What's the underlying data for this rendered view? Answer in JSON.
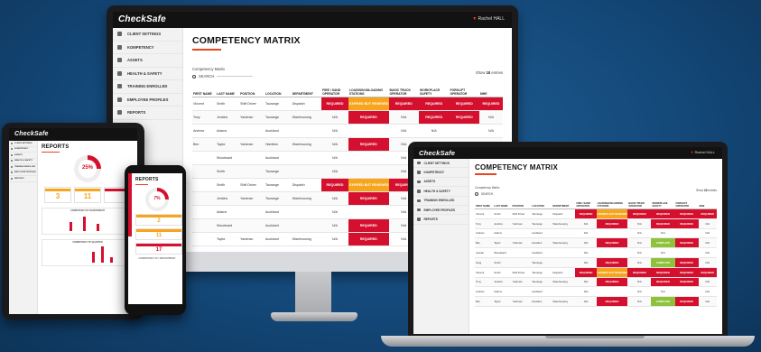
{
  "app": {
    "logo": "CheckSafe",
    "user": "Rachel HALL"
  },
  "sidebar": {
    "items": [
      {
        "label": "CLIENT SETTINGS",
        "icon": "gear-icon"
      },
      {
        "label": "KOMPETENCY",
        "icon": "check-icon"
      },
      {
        "label": "ASSETS",
        "icon": "box-icon"
      },
      {
        "label": "HEALTH & SAFETY",
        "icon": "cross-icon"
      },
      {
        "label": "TRAINING ENROLLED",
        "icon": "cap-icon"
      },
      {
        "label": "EMPLOYEE PROFILES",
        "icon": "user-icon"
      },
      {
        "label": "REPORTS",
        "icon": "chart-icon"
      }
    ]
  },
  "matrix": {
    "title": "COMPETENCY MATRIX",
    "subtitle": "Competency Matrix",
    "search_placeholder": "SEARCH",
    "show_label": "Show",
    "show_value": "10",
    "entries_label": "entries",
    "headers": [
      "FIRST NAME",
      "LAST NAME",
      "POSITION",
      "LOCATION",
      "DEPARTMENT",
      "FIRE / SAND OPERATOR",
      "LOADING/UNLOADING STATIONS",
      "BASIC TRUCK OPERATOR",
      "WORKPLACE SAFETY",
      "FORKLIFT OPERATOR",
      "MHE"
    ],
    "rows": [
      [
        "Vincent",
        "Smith",
        "Shift Driver",
        "Taurange",
        "Dispatch",
        "REQUIRED",
        "EXPIRED BUT RENEWED",
        "REQUIRED",
        "REQUIRED",
        "REQUIRED",
        "REQUIRED"
      ],
      [
        "Tony",
        "Jenkins",
        "Yardman",
        "Taurange",
        "Warehousing",
        "N/A",
        "REQUIRED",
        "N/A",
        "REQUIRED",
        "REQUIRED",
        "N/A"
      ],
      [
        "Andrew",
        "Adams",
        "",
        "Auckland",
        "",
        "N/A",
        "",
        "N/A",
        "N/A",
        "",
        "N/A"
      ],
      [
        "Ben",
        "Taylor",
        "Yardman",
        "Hamilton",
        "Warehousing",
        "N/A",
        "REQUIRED",
        "N/A",
        "N/A",
        "",
        "N/A"
      ],
      [
        "",
        "Woodward",
        "",
        "Auckland",
        "",
        "N/A",
        "",
        "N/A",
        "N/A",
        "",
        "N/A"
      ],
      [
        "",
        "Smith",
        "",
        "Taurange",
        "",
        "N/A",
        "",
        "N/A",
        "",
        "",
        "N/A"
      ],
      [
        "",
        "Smith",
        "Shift Driver",
        "Taurange",
        "Dispatch",
        "REQUIRED",
        "EXPIRED BUT RENEWED",
        "REQUIRED",
        "",
        "",
        ""
      ],
      [
        "",
        "Jenkins",
        "Yardman",
        "Taurange",
        "Warehousing",
        "N/A",
        "REQUIRED",
        "N/A",
        "",
        "",
        ""
      ],
      [
        "",
        "Adams",
        "",
        "Auckland",
        "",
        "N/A",
        "",
        "N/A",
        "",
        "",
        ""
      ],
      [
        "",
        "Woodward",
        "",
        "Auckland",
        "",
        "N/A",
        "REQUIRED",
        "N/A",
        "",
        "",
        ""
      ],
      [
        "",
        "Taylor",
        "Yardman",
        "Auckland",
        "Warehousing",
        "N/A",
        "REQUIRED",
        "N/A",
        "",
        "",
        ""
      ]
    ]
  },
  "laptop_matrix": {
    "rows": [
      [
        "Vincent",
        "Smith",
        "Shift Driver",
        "Taurange",
        "Dispatch",
        "REQUIRED",
        "EXPIRED BUT RENEWED",
        "REQUIRED",
        "REQUIRED",
        "REQUIRED",
        "REQUIRED"
      ],
      [
        "Tony",
        "Jenkins",
        "Yardman",
        "Taurange",
        "Warehousing",
        "N/A",
        "REQUIRED",
        "N/A",
        "REQUIRED",
        "REQUIRED",
        "N/A"
      ],
      [
        "Andrew",
        "Adams",
        "",
        "Auckland",
        "",
        "N/A",
        "",
        "N/A",
        "N/A",
        "",
        "N/A"
      ],
      [
        "Ben",
        "Taylor",
        "Yardman",
        "Hamilton",
        "Warehousing",
        "N/A",
        "REQUIRED",
        "N/A",
        "COMPLETE",
        "REQUIRED",
        "N/A"
      ],
      [
        "Joseph",
        "Woodward",
        "",
        "Auckland",
        "",
        "N/A",
        "",
        "N/A",
        "N/A",
        "",
        "N/A"
      ],
      [
        "Greg",
        "Smith",
        "",
        "Taurange",
        "",
        "N/A",
        "REQUIRED",
        "N/A",
        "COMPLETE",
        "REQUIRED",
        "N/A"
      ],
      [
        "Vincent",
        "Smith",
        "Shift Driver",
        "Taurange",
        "Dispatch",
        "REQUIRED",
        "EXPIRED BUT RENEWED",
        "REQUIRED",
        "REQUIRED",
        "REQUIRED",
        "REQUIRED"
      ],
      [
        "Tony",
        "Jenkins",
        "Yardman",
        "Taurange",
        "Warehousing",
        "N/A",
        "REQUIRED",
        "N/A",
        "REQUIRED",
        "REQUIRED",
        "N/A"
      ],
      [
        "Andrew",
        "Adams",
        "",
        "Auckland",
        "",
        "N/A",
        "",
        "N/A",
        "N/A",
        "",
        "N/A"
      ],
      [
        "Ben",
        "Taylor",
        "Yardman",
        "Hamilton",
        "Warehousing",
        "N/A",
        "REQUIRED",
        "N/A",
        "COMPLETE",
        "REQUIRED",
        "N/A"
      ]
    ]
  },
  "reports": {
    "title": "REPORTS",
    "gauge_value": "25%",
    "stats": [
      {
        "value": "3",
        "color": "#f7a51c"
      },
      {
        "value": "11",
        "color": "#f7a51c"
      },
      {
        "value": "",
        "color": "#d4102e"
      }
    ],
    "chart1_title": "COMPETENCY BY DEPARTMENT",
    "chart2_title": "COMPETENCY BY QUARTER"
  },
  "phone_reports": {
    "title": "REPORTS",
    "gauge_value": "7%",
    "stats": [
      {
        "value": "2",
        "color": "#f7a51c"
      },
      {
        "value": "11",
        "color": "#f7a51c"
      },
      {
        "value": "17",
        "color": "#d4102e"
      }
    ],
    "chart_title": "COMPETENCY BY DEPARTMENT"
  },
  "colors": {
    "accent": "#e8451b",
    "required": "#d4102e",
    "warning": "#f7a51c",
    "complete": "#8fc23b",
    "background": "#14497a"
  }
}
